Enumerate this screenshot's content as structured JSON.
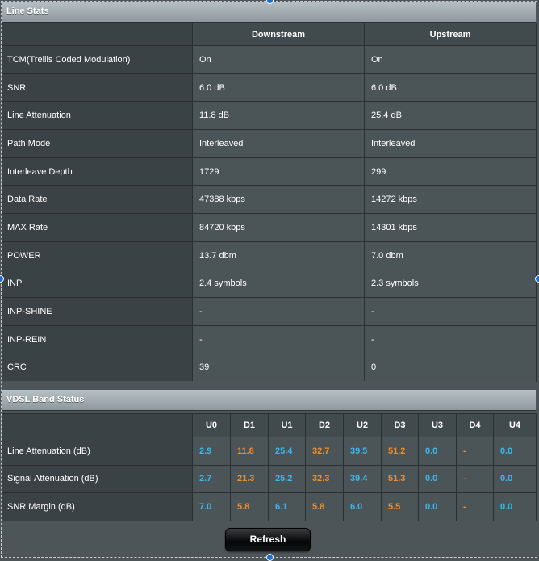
{
  "line_stats": {
    "title": "Line Stats",
    "headers": {
      "corner": "",
      "downstream": "Downstream",
      "upstream": "Upstream"
    },
    "rows": [
      {
        "label": "TCM(Trellis Coded Modulation)",
        "down": "On",
        "up": "On"
      },
      {
        "label": "SNR",
        "down": "6.0 dB",
        "up": "6.0 dB"
      },
      {
        "label": "Line Attenuation",
        "down": "11.8 dB",
        "up": "25.4 dB"
      },
      {
        "label": "Path Mode",
        "down": "Interleaved",
        "up": "Interleaved"
      },
      {
        "label": "Interleave Depth",
        "down": "1729",
        "up": "299"
      },
      {
        "label": "Data Rate",
        "down": "47388 kbps",
        "up": "14272 kbps"
      },
      {
        "label": "MAX Rate",
        "down": "84720 kbps",
        "up": "14301 kbps"
      },
      {
        "label": "POWER",
        "down": "13.7 dbm",
        "up": "7.0 dbm"
      },
      {
        "label": "INP",
        "down": "2.4 symbols",
        "up": "2.3 symbols"
      },
      {
        "label": "INP-SHINE",
        "down": "-",
        "up": "-"
      },
      {
        "label": "INP-REIN",
        "down": "-",
        "up": "-"
      },
      {
        "label": "CRC",
        "down": "39",
        "up": "0"
      }
    ]
  },
  "vdsl_band": {
    "title": "VDSL Band Status",
    "bands": [
      "U0",
      "D1",
      "U1",
      "D2",
      "U2",
      "D3",
      "U3",
      "D4",
      "U4"
    ],
    "colors": {
      "upstream": "#3bb7ec",
      "downstream": "#f08c2a"
    },
    "rows": [
      {
        "label": "Line Attenuation (dB)",
        "values": [
          "2.9",
          "11.8",
          "25.4",
          "32.7",
          "39.5",
          "51.2",
          "0.0",
          "-",
          "0.0"
        ]
      },
      {
        "label": "Signal Attenuation (dB)",
        "values": [
          "2.7",
          "21.3",
          "25.2",
          "32.3",
          "39.4",
          "51.3",
          "0.0",
          "-",
          "0.0"
        ]
      },
      {
        "label": "SNR Margin (dB)",
        "values": [
          "7.0",
          "5.8",
          "6.1",
          "5.8",
          "6.0",
          "5.5",
          "0.0",
          "-",
          "0.0"
        ]
      }
    ]
  },
  "refresh": {
    "label": "Refresh"
  }
}
